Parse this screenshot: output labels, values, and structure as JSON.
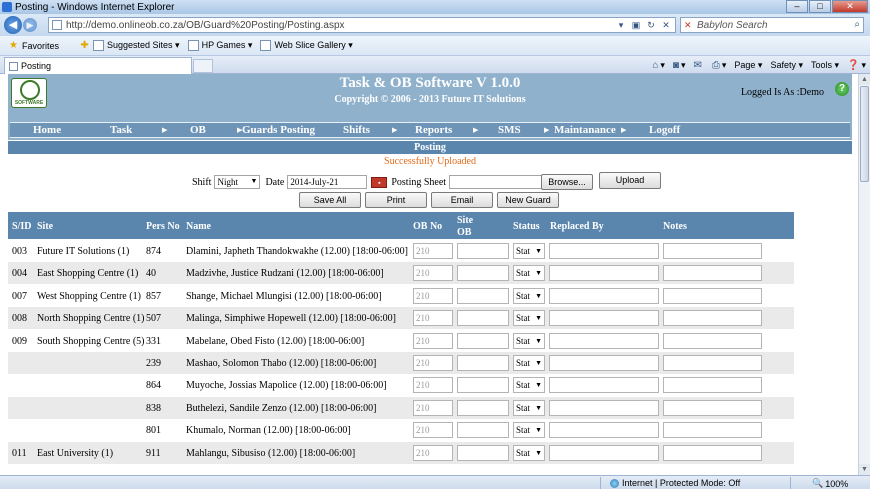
{
  "browser": {
    "window_title": "Posting - Windows Internet Explorer",
    "url": "http://demo.onlineob.co.za/OB/Guard%20Posting/Posting.aspx",
    "search_placeholder": "Babylon Search",
    "favorites": [
      "Favorites",
      "Suggested Sites ▾",
      "HP Games ▾",
      "Web Slice Gallery ▾"
    ],
    "tab_title": "Posting",
    "commands": [
      "Page ▾",
      "Safety ▾",
      "Tools ▾"
    ],
    "status_zone": "Internet | Protected Mode: Off",
    "zoom": "100%"
  },
  "app": {
    "title": "Task & OB Software V 1.0.0",
    "copyright": "Copyright © 2006 - 2013 Future IT Solutions",
    "logged_in": "Logged Is As :Demo",
    "logo_text": "SOFTWARE",
    "menu": [
      "Home",
      "Task",
      "OB",
      "Guards Posting",
      "Shifts",
      "Reports",
      "SMS",
      "Maintanance",
      "Logoff"
    ],
    "section_title": "Posting",
    "message": "Successfully Uploaded",
    "accent_color": "#5a86ad",
    "message_color": "#e06a1a"
  },
  "form": {
    "shift_label": "Shift",
    "shift_value": "Night",
    "date_label": "Date",
    "date_value": "2014-July-21",
    "posting_sheet_label": "Posting Sheet",
    "browse_label": "Browse...",
    "upload_label": "Upload",
    "save_all_label": "Save All",
    "print_label": "Print",
    "email_label": "Email",
    "new_guard_label": "New Guard"
  },
  "table": {
    "headers": {
      "sid": "S/ID",
      "site": "Site",
      "pers_no": "Pers No",
      "name": "Name",
      "ob_no": "OB No",
      "site_ob_1": "Site",
      "site_ob_2": "OB",
      "status": "Status",
      "replaced_by": "Replaced By",
      "notes": "Notes"
    },
    "ob_placeholder": "210",
    "status_value": "Stat",
    "rows": [
      {
        "sid": "003",
        "site": "Future IT Solutions (1)",
        "pers": "874",
        "name": "Dlamini, Japheth Thandokwakhe (12.00) [18:00-06:00]"
      },
      {
        "sid": "004",
        "site": "East Shopping Centre (1)",
        "pers": "40",
        "name": "Madzivhe, Justice Rudzani (12.00) [18:00-06:00]"
      },
      {
        "sid": "007",
        "site": "West Shopping Centre (1)",
        "pers": "857",
        "name": "Shange, Michael Mlungisi (12.00) [18:00-06:00]"
      },
      {
        "sid": "008",
        "site": "North Shopping Centre (1)",
        "pers": "507",
        "name": "Malinga, Simphiwe Hopewell (12.00) [18:00-06:00]"
      },
      {
        "sid": "009",
        "site": "South Shopping Centre (5)",
        "pers": "331",
        "name": "Mabelane, Obed Fisto (12.00) [18:00-06:00]"
      },
      {
        "sid": "",
        "site": "",
        "pers": "239",
        "name": "Mashao, Solomon Thabo (12.00) [18:00-06:00]"
      },
      {
        "sid": "",
        "site": "",
        "pers": "864",
        "name": "Muyoche, Jossias Mapolice (12.00) [18:00-06:00]"
      },
      {
        "sid": "",
        "site": "",
        "pers": "838",
        "name": "Buthelezi, Sandile Zenzo (12.00) [18:00-06:00]"
      },
      {
        "sid": "",
        "site": "",
        "pers": "801",
        "name": "Khumalo, Norman (12.00) [18:00-06:00]"
      },
      {
        "sid": "011",
        "site": "East University (1)",
        "pers": "911",
        "name": "Mahlangu, Sibusiso (12.00) [18:00-06:00]"
      }
    ]
  }
}
